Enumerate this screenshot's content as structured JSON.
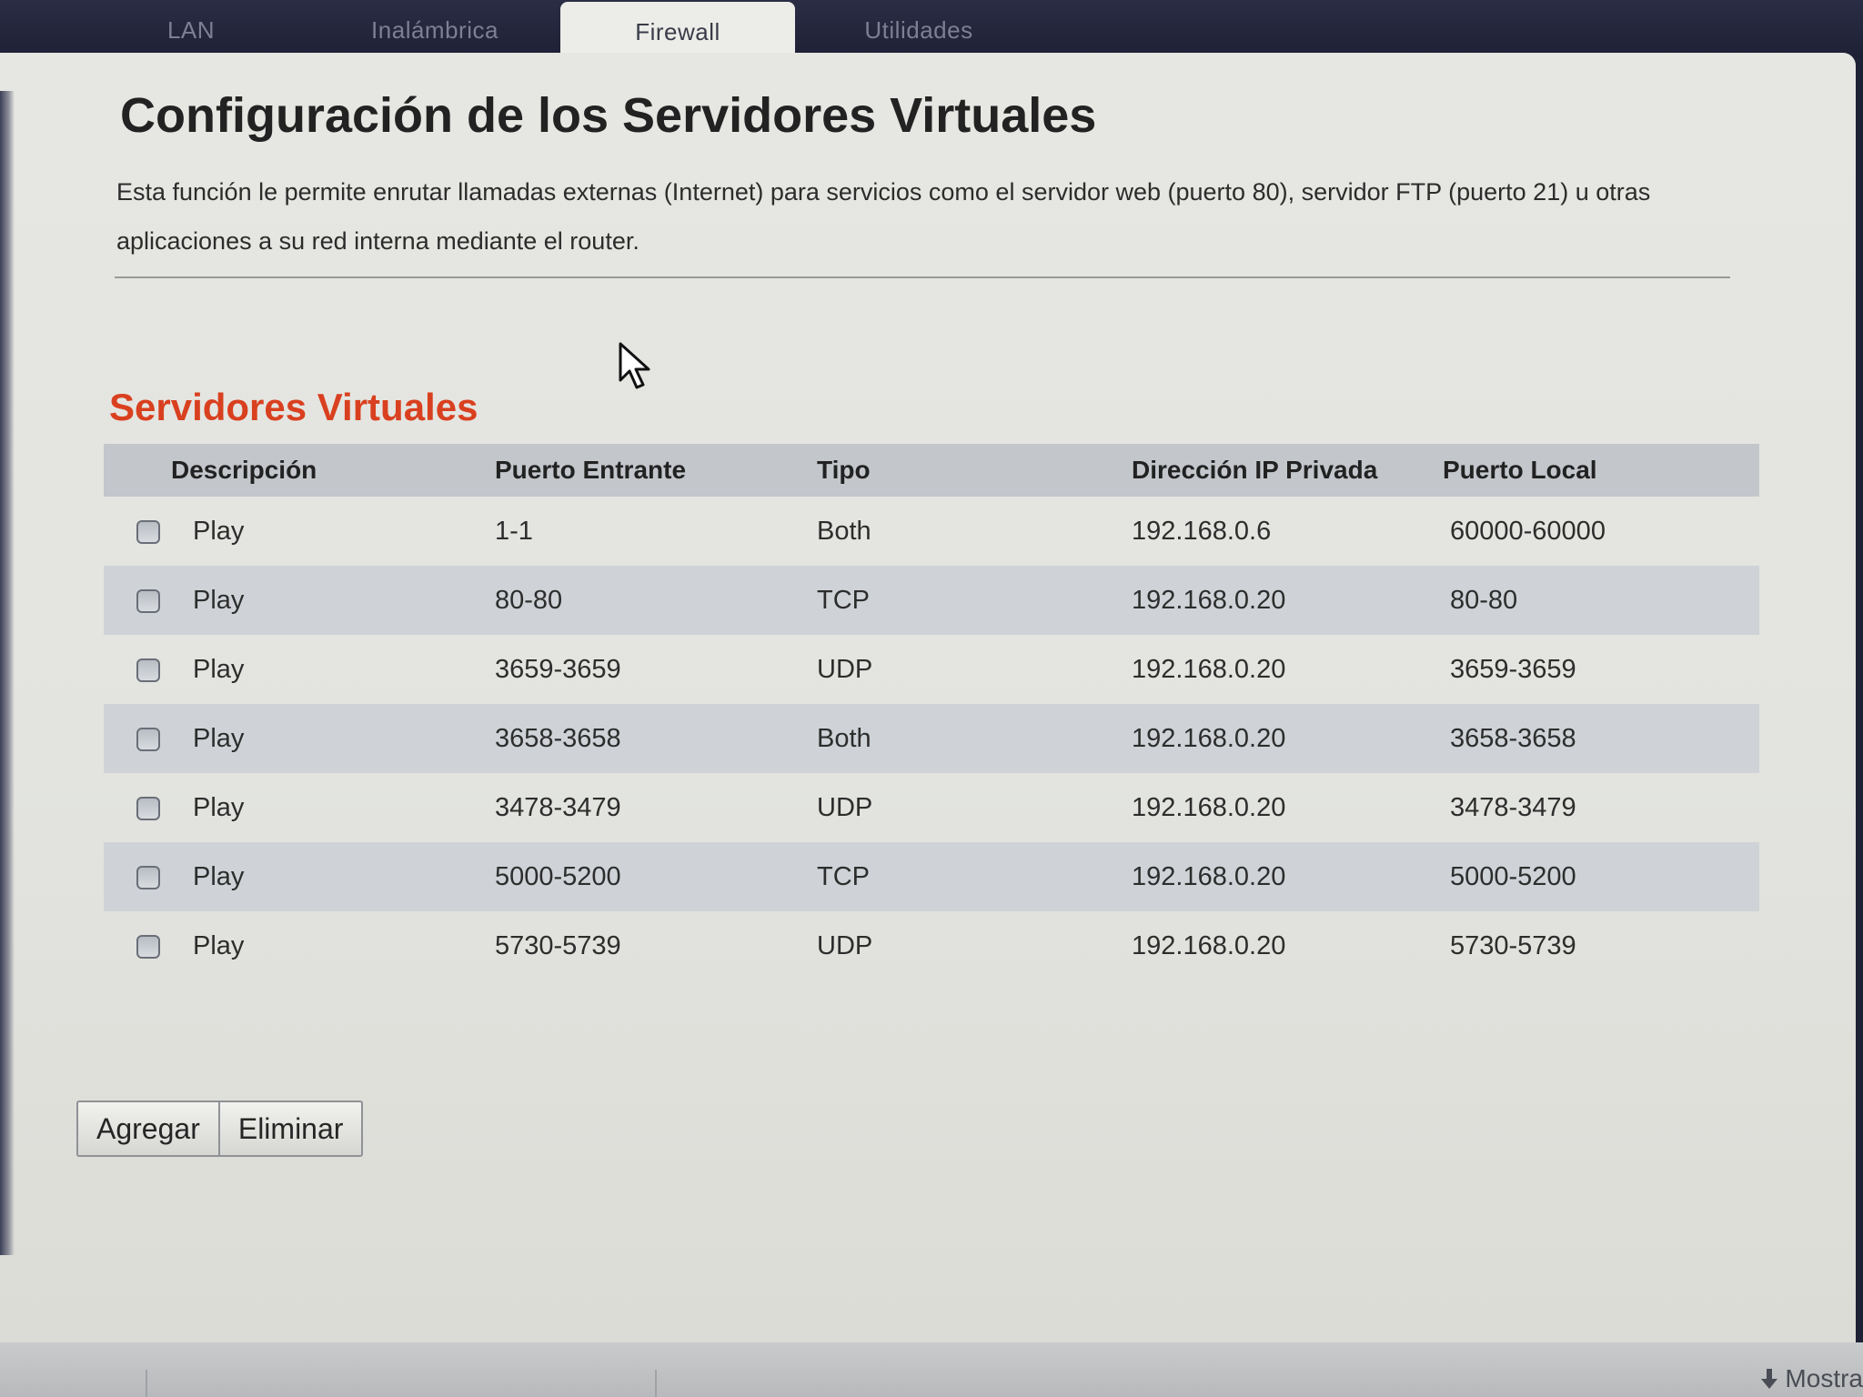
{
  "tabs": [
    {
      "label": "LAN",
      "active": false
    },
    {
      "label": "Inalámbrica",
      "active": false
    },
    {
      "label": "Firewall",
      "active": true
    },
    {
      "label": "Utilidades",
      "active": false
    }
  ],
  "page": {
    "title": "Configuración de los Servidores Virtuales",
    "description": "Esta función le permite enrutar llamadas externas (Internet) para servicios como el servidor web (puerto 80), servidor FTP (puerto 21) u otras aplicaciones a su red interna mediante el router."
  },
  "section": {
    "title": "Servidores Virtuales"
  },
  "table": {
    "headers": {
      "description": "Descripción",
      "incoming_port": "Puerto Entrante",
      "type": "Tipo",
      "private_ip": "Dirección IP Privada",
      "local_port": "Puerto Local"
    },
    "rows": [
      {
        "description": "Play",
        "incoming_port": "1-1",
        "type": "Both",
        "private_ip": "192.168.0.6",
        "local_port": "60000-60000"
      },
      {
        "description": "Play",
        "incoming_port": "80-80",
        "type": "TCP",
        "private_ip": "192.168.0.20",
        "local_port": "80-80"
      },
      {
        "description": "Play",
        "incoming_port": "3659-3659",
        "type": "UDP",
        "private_ip": "192.168.0.20",
        "local_port": "3659-3659"
      },
      {
        "description": "Play",
        "incoming_port": "3658-3658",
        "type": "Both",
        "private_ip": "192.168.0.20",
        "local_port": "3658-3658"
      },
      {
        "description": "Play",
        "incoming_port": "3478-3479",
        "type": "UDP",
        "private_ip": "192.168.0.20",
        "local_port": "3478-3479"
      },
      {
        "description": "Play",
        "incoming_port": "5000-5200",
        "type": "TCP",
        "private_ip": "192.168.0.20",
        "local_port": "5000-5200"
      },
      {
        "description": "Play",
        "incoming_port": "5730-5739",
        "type": "UDP",
        "private_ip": "192.168.0.20",
        "local_port": "5730-5739"
      }
    ]
  },
  "buttons": {
    "add": "Agregar",
    "delete": "Eliminar"
  },
  "bottom_bar": {
    "label": "Mostra"
  },
  "colors": {
    "accent": "#d9401f",
    "tab_bar": "#1e2035",
    "row_alt": "#cfd3d7",
    "header_bg": "#c3c7cc"
  },
  "icons": {
    "cursor": "cursor-arrow-icon",
    "download": "download-arrow-icon"
  }
}
